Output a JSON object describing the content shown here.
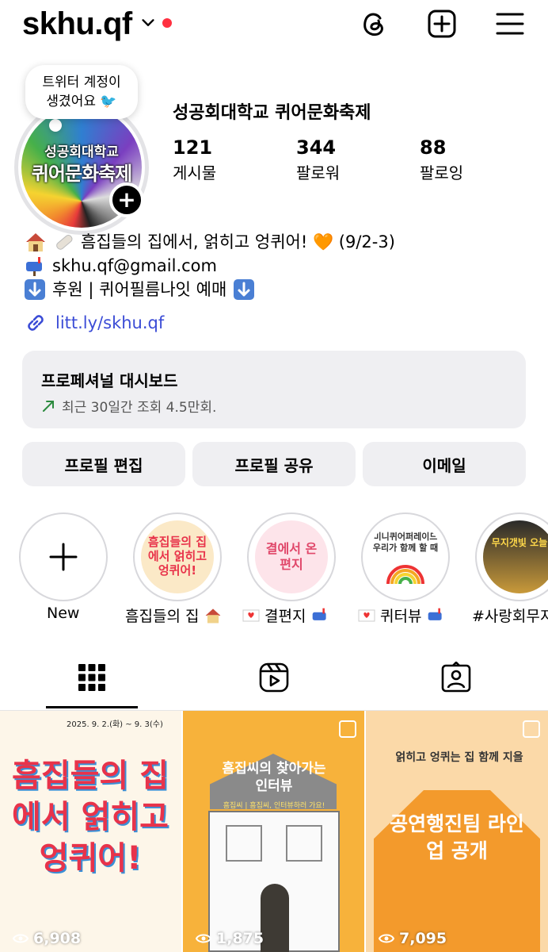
{
  "header": {
    "username": "skhu.qf",
    "icons": [
      "threads-icon",
      "add-post-icon",
      "menu-icon"
    ],
    "notification_dot_color": "#ff3040"
  },
  "profile": {
    "note": "트위터 계정이 생겼어요 🐦",
    "avatar_text_line1": "성공회대학교",
    "avatar_text_line2": "퀴어문화축제",
    "full_name": "성공회대학교 퀴어문화축제",
    "stats": [
      {
        "value": "121",
        "label": "게시물"
      },
      {
        "value": "344",
        "label": "팔로워"
      },
      {
        "value": "88",
        "label": "팔로잉"
      }
    ],
    "bio": [
      "흠집들의 집에서, 얽히고 엉퀴어! 🧡  (9/2-3)",
      "skhu.qf@gmail.com",
      "후원 | 퀴어필름나잇 예매"
    ],
    "link": "litt.ly/skhu.qf"
  },
  "dashboard": {
    "title": "프로페셔널 대시보드",
    "subtitle": "최근 30일간 조회 4.5만회."
  },
  "buttons": {
    "edit_profile": "프로필 편집",
    "share_profile": "프로필 공유",
    "email": "이메일"
  },
  "highlights": [
    {
      "label": "New"
    },
    {
      "label": "흠집들의 집",
      "cover": "흠집들의 집에서 얽히고 엉퀴어!"
    },
    {
      "label": "결편지",
      "cover": "결에서 온 편지"
    },
    {
      "label": "퀴터뷰",
      "cover": "미니퀴어퍼레이드 우리가 함께 할 때"
    },
    {
      "label": "#사랑회무지",
      "cover": "무지갯빛 오늘"
    }
  ],
  "tabs": [
    "grid-tab",
    "reels-tab",
    "tagged-tab"
  ],
  "posts": [
    {
      "views": "6,908",
      "title": "흠집들의 집에서 얽히고 엉퀴어!",
      "date": "2025. 9. 2.(화) ~ 9. 3(수)"
    },
    {
      "views": "1,875",
      "title": "흠집씨의 찾아가는 인터뷰",
      "subtitle": "흠집씨 | 흠집씨, 인터뷰하러 가요!"
    },
    {
      "views": "7,095",
      "title": "공연행진팀 라인업 공개",
      "header": "얽히고 엉퀴는 집 함께 지을"
    }
  ],
  "colors": {
    "link": "#3b4cd6",
    "panel_bg": "#efeff2",
    "growth_arrow": "#2b8a3e"
  }
}
